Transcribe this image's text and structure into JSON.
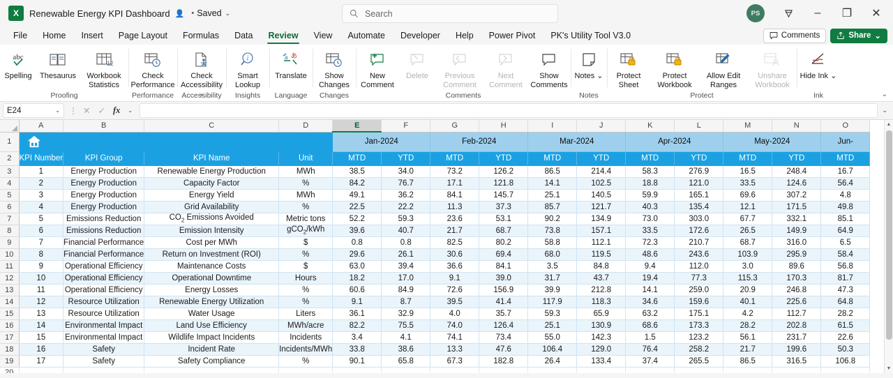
{
  "titlebar": {
    "app_logo": "excel-logo",
    "doc_title": "Renewable Energy KPI Dashboard",
    "pin_icon": "pin-person-icon",
    "separator": "•",
    "saved_label": "Saved",
    "saved_chevron": "⌄",
    "avatar_initials": "PS",
    "diamond_icon": "diamond-icon",
    "minimize_icon": "–",
    "restore_icon": "❐",
    "close_icon": "✕"
  },
  "search": {
    "placeholder": "Search",
    "icon": "search-icon"
  },
  "tabs": [
    {
      "label": "File",
      "active": false
    },
    {
      "label": "Home",
      "active": false
    },
    {
      "label": "Insert",
      "active": false
    },
    {
      "label": "Page Layout",
      "active": false
    },
    {
      "label": "Formulas",
      "active": false
    },
    {
      "label": "Data",
      "active": false
    },
    {
      "label": "Review",
      "active": true
    },
    {
      "label": "View",
      "active": false
    },
    {
      "label": "Automate",
      "active": false
    },
    {
      "label": "Developer",
      "active": false
    },
    {
      "label": "Help",
      "active": false
    },
    {
      "label": "Power Pivot",
      "active": false
    },
    {
      "label": "PK's Utility Tool V3.0",
      "active": false
    }
  ],
  "tabbar_right": {
    "comments_label": "Comments",
    "comments_icon": "comment-icon",
    "share_label": "Share",
    "share_icon": "share-icon",
    "share_chevron": "⌄"
  },
  "ribbon": {
    "collapse_icon": "⌄",
    "groups": [
      {
        "name": "Proofing",
        "items": [
          {
            "label": "Spelling",
            "icon": "abc-check-icon",
            "disabled": false
          },
          {
            "label": "Thesaurus",
            "icon": "book-icon",
            "disabled": false
          },
          {
            "label": "Workbook Statistics",
            "icon": "table-123-icon",
            "disabled": false
          }
        ]
      },
      {
        "name": "Performance",
        "items": [
          {
            "label": "Check Performance",
            "icon": "table-clock-icon",
            "disabled": false
          }
        ]
      },
      {
        "name": "Accessibility",
        "items": [
          {
            "label": "Check Accessibility ⌄",
            "icon": "page-person-icon",
            "disabled": false
          }
        ]
      },
      {
        "name": "Insights",
        "items": [
          {
            "label": "Smart Lookup",
            "icon": "magnifier-info-icon",
            "disabled": false
          }
        ]
      },
      {
        "name": "Language",
        "items": [
          {
            "label": "Translate",
            "icon": "translate-icon",
            "disabled": false
          }
        ]
      },
      {
        "name": "Changes",
        "items": [
          {
            "label": "Show Changes",
            "icon": "table-history-icon",
            "disabled": false
          }
        ]
      },
      {
        "name": "Comments",
        "items": [
          {
            "label": "New Comment",
            "icon": "comment-plus-icon",
            "disabled": false
          },
          {
            "label": "Delete",
            "icon": "comment-delete-icon",
            "disabled": true
          },
          {
            "label": "Previous Comment",
            "icon": "comment-prev-icon",
            "disabled": true
          },
          {
            "label": "Next Comment",
            "icon": "comment-next-icon",
            "disabled": true
          },
          {
            "label": "Show Comments",
            "icon": "comment-show-icon",
            "disabled": false
          }
        ]
      },
      {
        "name": "Notes",
        "items": [
          {
            "label": "Notes ⌄",
            "icon": "note-icon",
            "disabled": false
          }
        ]
      },
      {
        "name": "Protect",
        "items": [
          {
            "label": "Protect Sheet",
            "icon": "sheet-lock-icon",
            "disabled": false
          },
          {
            "label": "Protect Workbook",
            "icon": "workbook-lock-icon",
            "disabled": false
          },
          {
            "label": "Allow Edit Ranges",
            "icon": "pencil-table-icon",
            "disabled": false
          },
          {
            "label": "Unshare Workbook",
            "icon": "unshare-icon",
            "disabled": true
          }
        ]
      },
      {
        "name": "Ink",
        "items": [
          {
            "label": "Hide Ink ⌄",
            "icon": "ink-icon",
            "disabled": false
          }
        ]
      }
    ]
  },
  "formulabar": {
    "namebox_value": "E24",
    "namebox_chevron": "⌄",
    "cancel_icon": "✕",
    "enter_icon": "✓",
    "fx_icon": "fx",
    "fx_chevron": "⌄",
    "formula_value": "",
    "expand_icon": "⌄"
  },
  "grid": {
    "columns": [
      "A",
      "B",
      "C",
      "D",
      "E",
      "F",
      "G",
      "H",
      "I",
      "J",
      "K",
      "L",
      "M",
      "N",
      "O"
    ],
    "selected_column": "E",
    "row_numbers": [
      "1",
      "2",
      "3",
      "4",
      "5",
      "6",
      "7",
      "8",
      "9",
      "10",
      "11",
      "12",
      "13",
      "14",
      "15",
      "16",
      "17",
      "18",
      "19",
      "20"
    ],
    "home_icon": "home-icon",
    "months": [
      {
        "label": "Jan-2024",
        "span": 2
      },
      {
        "label": "Feb-2024",
        "span": 2
      },
      {
        "label": "Mar-2024",
        "span": 2
      },
      {
        "label": "Apr-2024",
        "span": 2
      },
      {
        "label": "May-2024",
        "span": 2
      },
      {
        "label": "Jun-",
        "span": 1
      }
    ],
    "headers": [
      "KPI Number",
      "KPI Group",
      "KPI Name",
      "Unit",
      "MTD",
      "YTD",
      "MTD",
      "YTD",
      "MTD",
      "YTD",
      "MTD",
      "YTD",
      "MTD",
      "YTD",
      "MTD"
    ],
    "rows": [
      {
        "num": "1",
        "group": "Energy Production",
        "name": "Renewable Energy Production",
        "unit": "MWh",
        "values": [
          "38.5",
          "34.0",
          "73.2",
          "126.2",
          "86.5",
          "214.4",
          "58.3",
          "276.9",
          "16.5",
          "248.4",
          "16.7"
        ]
      },
      {
        "num": "2",
        "group": "Energy Production",
        "name": "Capacity Factor",
        "unit": "%",
        "values": [
          "84.2",
          "76.7",
          "17.1",
          "121.8",
          "14.1",
          "102.5",
          "18.8",
          "121.0",
          "33.5",
          "124.6",
          "56.4"
        ]
      },
      {
        "num": "3",
        "group": "Energy Production",
        "name": "Energy Yield",
        "unit": "MWh",
        "values": [
          "49.1",
          "36.2",
          "84.1",
          "145.7",
          "25.1",
          "140.5",
          "59.9",
          "165.1",
          "69.6",
          "307.2",
          "4.8"
        ]
      },
      {
        "num": "4",
        "group": "Energy Production",
        "name": "Grid Availability",
        "unit": "%",
        "values": [
          "22.5",
          "22.2",
          "11.3",
          "37.3",
          "85.7",
          "121.7",
          "40.3",
          "135.4",
          "12.1",
          "171.5",
          "49.8"
        ]
      },
      {
        "num": "5",
        "group": "Emissions Reduction",
        "name": "CO₂ Emissions Avoided",
        "unit": "Metric tons",
        "values": [
          "52.2",
          "59.3",
          "23.6",
          "53.1",
          "90.2",
          "134.9",
          "73.0",
          "303.0",
          "67.7",
          "332.1",
          "85.1"
        ]
      },
      {
        "num": "6",
        "group": "Emissions Reduction",
        "name": "Emission Intensity",
        "unit": "gCO₂/kWh",
        "values": [
          "39.6",
          "40.7",
          "21.7",
          "68.7",
          "73.8",
          "157.1",
          "33.5",
          "172.6",
          "26.5",
          "149.9",
          "64.9"
        ]
      },
      {
        "num": "7",
        "group": "Financial Performance",
        "name": "Cost per MWh",
        "unit": "$",
        "values": [
          "0.8",
          "0.8",
          "82.5",
          "80.2",
          "58.8",
          "112.1",
          "72.3",
          "210.7",
          "68.7",
          "316.0",
          "6.5"
        ]
      },
      {
        "num": "8",
        "group": "Financial Performance",
        "name": "Return on Investment (ROI)",
        "unit": "%",
        "values": [
          "29.6",
          "26.1",
          "30.6",
          "69.4",
          "68.0",
          "119.5",
          "48.6",
          "243.6",
          "103.9",
          "295.9",
          "58.4"
        ]
      },
      {
        "num": "9",
        "group": "Operational Efficiency",
        "name": "Maintenance Costs",
        "unit": "$",
        "values": [
          "63.0",
          "39.4",
          "36.6",
          "84.1",
          "3.5",
          "84.8",
          "9.4",
          "112.0",
          "3.0",
          "89.6",
          "56.8"
        ]
      },
      {
        "num": "10",
        "group": "Operational Efficiency",
        "name": "Operational Downtime",
        "unit": "Hours",
        "values": [
          "18.2",
          "17.0",
          "9.1",
          "39.0",
          "31.7",
          "43.7",
          "19.4",
          "77.3",
          "115.3",
          "170.3",
          "81.7"
        ]
      },
      {
        "num": "11",
        "group": "Operational Efficiency",
        "name": "Energy Losses",
        "unit": "%",
        "values": [
          "60.6",
          "84.9",
          "72.6",
          "156.9",
          "39.9",
          "212.8",
          "14.1",
          "259.0",
          "20.9",
          "246.8",
          "47.3"
        ]
      },
      {
        "num": "12",
        "group": "Resource Utilization",
        "name": "Renewable Energy Utilization",
        "unit": "%",
        "values": [
          "9.1",
          "8.7",
          "39.5",
          "41.4",
          "117.9",
          "118.3",
          "34.6",
          "159.6",
          "40.1",
          "225.6",
          "64.8"
        ]
      },
      {
        "num": "13",
        "group": "Resource Utilization",
        "name": "Water Usage",
        "unit": "Liters",
        "values": [
          "36.1",
          "32.9",
          "4.0",
          "35.7",
          "59.3",
          "65.9",
          "63.2",
          "175.1",
          "4.2",
          "112.7",
          "28.2"
        ]
      },
      {
        "num": "14",
        "group": "Environmental Impact",
        "name": "Land Use Efficiency",
        "unit": "MWh/acre",
        "values": [
          "82.2",
          "75.5",
          "74.0",
          "126.4",
          "25.1",
          "130.9",
          "68.6",
          "173.3",
          "28.2",
          "202.8",
          "61.5"
        ]
      },
      {
        "num": "15",
        "group": "Environmental Impact",
        "name": "Wildlife Impact Incidents",
        "unit": "Incidents",
        "values": [
          "3.4",
          "4.1",
          "74.1",
          "73.4",
          "55.0",
          "142.3",
          "1.5",
          "123.2",
          "56.1",
          "231.7",
          "22.6"
        ]
      },
      {
        "num": "16",
        "group": "Safety",
        "name": "Incident Rate",
        "unit": "Incidents/MWh",
        "values": [
          "33.8",
          "38.6",
          "13.3",
          "47.6",
          "106.4",
          "129.0",
          "76.4",
          "258.2",
          "21.7",
          "199.6",
          "50.3"
        ]
      },
      {
        "num": "17",
        "group": "Safety",
        "name": "Safety Compliance",
        "unit": "%",
        "values": [
          "90.1",
          "65.8",
          "67.3",
          "182.8",
          "26.4",
          "133.4",
          "37.4",
          "265.5",
          "86.5",
          "316.5",
          "106.8"
        ]
      }
    ]
  },
  "scrollbar": {
    "up_icon": "▲",
    "down_icon": "▼"
  }
}
